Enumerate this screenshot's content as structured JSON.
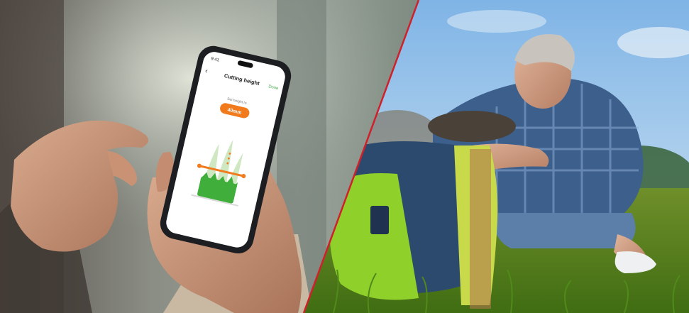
{
  "left_photo": {
    "description_label": "",
    "phone": {
      "status_time": "9:41",
      "back_icon": "chevron-left-icon",
      "header_title": "Cutting height",
      "header_action": "Done",
      "subtitle": "Set height to",
      "height_value": "40mm",
      "accent_color": "#F07A1C",
      "action_color": "#4CAF50"
    }
  },
  "right_photo": {
    "description_label": ""
  },
  "divider": {
    "color": "#D0202A"
  }
}
